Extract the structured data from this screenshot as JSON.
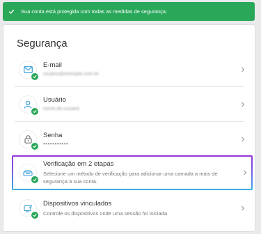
{
  "banner": {
    "text": "Sua conta está protegida com todas as medidas de segurança."
  },
  "card": {
    "title": "Segurança"
  },
  "items": [
    {
      "label": "E-mail",
      "value": "usuario@exemplo.com.br",
      "icon": "mail-icon"
    },
    {
      "label": "Usuário",
      "value": "nome.de.usuario",
      "icon": "user-icon"
    },
    {
      "label": "Senha",
      "value": "•••••••••••",
      "icon": "lock-icon"
    },
    {
      "label": "Verificação em 2 etapas",
      "description": "Selecione um método de verificação para adicionar uma camada a mais de segurança à sua conta.",
      "icon": "shield-icon"
    },
    {
      "label": "Dispositivos vinculados",
      "description": "Controle os dispositivos onde uma sessão foi iniciada.",
      "icon": "device-icon"
    }
  ],
  "colors": {
    "accent": "#29a85a",
    "icon": "#3a9fd8",
    "highlight_top": "#9b34d8",
    "highlight_bottom": "#3ab0e8"
  }
}
